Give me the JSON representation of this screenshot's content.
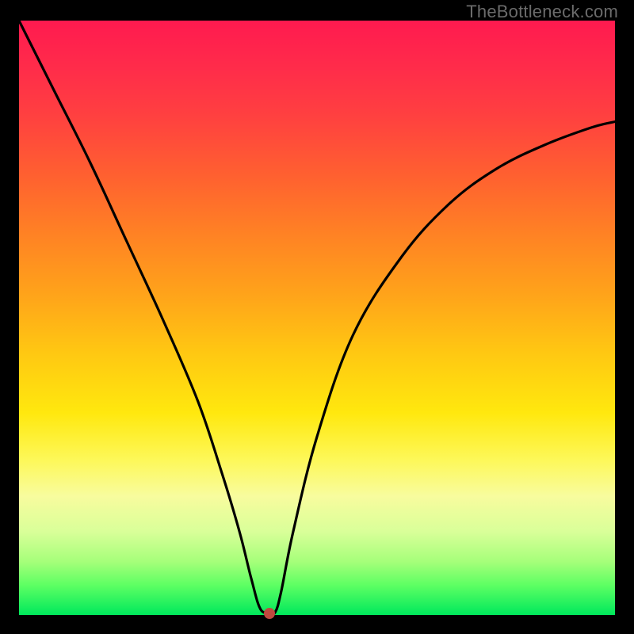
{
  "watermark": "TheBottleneck.com",
  "chart_data": {
    "type": "line",
    "title": "",
    "xlabel": "",
    "ylabel": "",
    "yaxis_meaning": "bottleneck severity (red = high, green = low)",
    "xlim": [
      0,
      100
    ],
    "ylim": [
      0,
      100
    ],
    "series": [
      {
        "name": "bottleneck-curve",
        "x": [
          0,
          6,
          12,
          18,
          24,
          30,
          34,
          37,
          39,
          40.5,
          42,
          43,
          44,
          46,
          50,
          56,
          64,
          72,
          80,
          88,
          96,
          100
        ],
        "y": [
          100,
          88,
          76,
          63,
          50,
          36,
          24,
          14,
          6,
          1,
          0.5,
          0.5,
          4,
          14,
          30,
          47,
          60,
          69,
          75,
          79,
          82,
          83
        ]
      }
    ],
    "optimal_point": {
      "x": 42,
      "y": 0.3
    },
    "background_gradient": {
      "orientation": "vertical",
      "stops": [
        {
          "pos": 0.0,
          "color": "#ff1a4f"
        },
        {
          "pos": 0.5,
          "color": "#ffc812"
        },
        {
          "pos": 0.8,
          "color": "#f8fc9e"
        },
        {
          "pos": 1.0,
          "color": "#00e85c"
        }
      ]
    }
  }
}
